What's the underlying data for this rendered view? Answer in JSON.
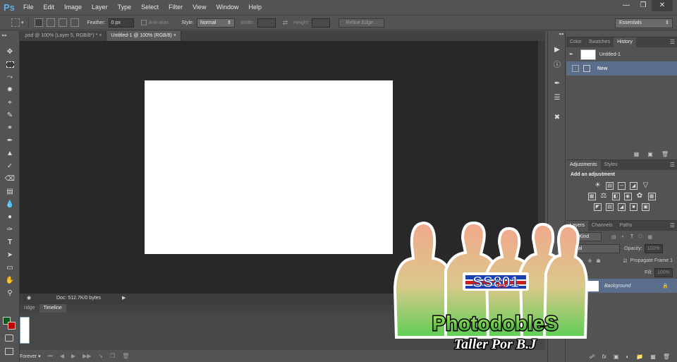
{
  "app": {
    "logo": "Ps",
    "menu": [
      "File",
      "Edit",
      "Image",
      "Layer",
      "Type",
      "Select",
      "Filter",
      "View",
      "Window",
      "Help"
    ],
    "window_controls": [
      "minimize-icon",
      "restore-icon",
      "close-icon"
    ]
  },
  "options": {
    "feather_label": "Feather:",
    "feather_value": "0 px",
    "antialias_label": "Anti-alias",
    "style_label": "Style:",
    "style_value": "Normal",
    "width_label": "Width:",
    "height_label": "Height:",
    "refine_edge": "Refine Edge...",
    "workspace": "Essentials"
  },
  "documents": {
    "tabs": [
      {
        "label": ".psd @ 100% (Layer 5, RGB/8*) *",
        "active": false
      },
      {
        "label": "Untitled-1 @ 100% (RGB/8)",
        "active": true
      }
    ],
    "status": "Doc: 512.7K/0 bytes"
  },
  "timeline": {
    "tabs": [
      "ridge",
      "Timeline"
    ],
    "loop": "Forever"
  },
  "history_panel": {
    "tabs": [
      "Color",
      "Swatches",
      "History"
    ],
    "snapshot": "Untitled-1",
    "states": [
      "New"
    ]
  },
  "adjustments_panel": {
    "tabs": [
      "Adjustments",
      "Styles"
    ],
    "title": "Add an adjustment"
  },
  "layers_panel": {
    "tabs": [
      "Layers",
      "Channels",
      "Paths"
    ],
    "filter_kind": "Kind",
    "blend_mode": "mal",
    "opacity_label": "Opacity:",
    "opacity_value": "100%",
    "propagate_label": "Propagate Frame 1",
    "fill_label": "Fill:",
    "fill_value": "100%",
    "layer_name": "Background"
  },
  "watermark": {
    "badge": "SS801",
    "badge_small": "PR",
    "title": "PhotodobleS",
    "subtitle": "Taller Por B.J"
  },
  "colors": {
    "foreground": "#0a5a1a",
    "background": "#c00000",
    "selection": "#5a6e8c"
  }
}
